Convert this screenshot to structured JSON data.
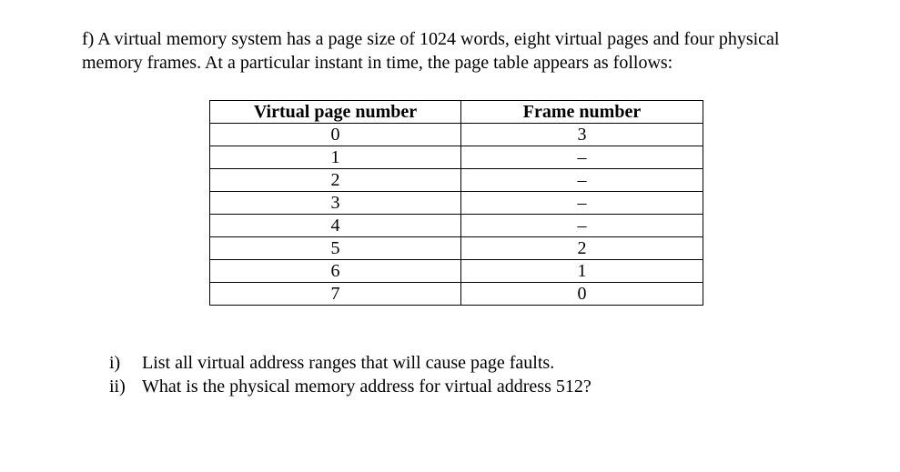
{
  "problem": {
    "statement": "f) A virtual memory system has a page size of 1024 words, eight virtual pages and four physical memory frames. At a particular instant in time, the page table appears as follows:"
  },
  "table": {
    "header": {
      "col1": "Virtual page number",
      "col2": "Frame number"
    },
    "rows": [
      {
        "vpn": "0",
        "frame": "3"
      },
      {
        "vpn": "1",
        "frame": "–"
      },
      {
        "vpn": "2",
        "frame": "–"
      },
      {
        "vpn": "3",
        "frame": "–"
      },
      {
        "vpn": "4",
        "frame": "–"
      },
      {
        "vpn": "5",
        "frame": "2"
      },
      {
        "vpn": "6",
        "frame": "1"
      },
      {
        "vpn": "7",
        "frame": "0"
      }
    ]
  },
  "questions": {
    "q1": {
      "marker": "i)",
      "text": "List all virtual address ranges that will cause page faults."
    },
    "q2": {
      "marker": "ii)",
      "text": "What is the physical memory address for virtual address 512?"
    }
  }
}
